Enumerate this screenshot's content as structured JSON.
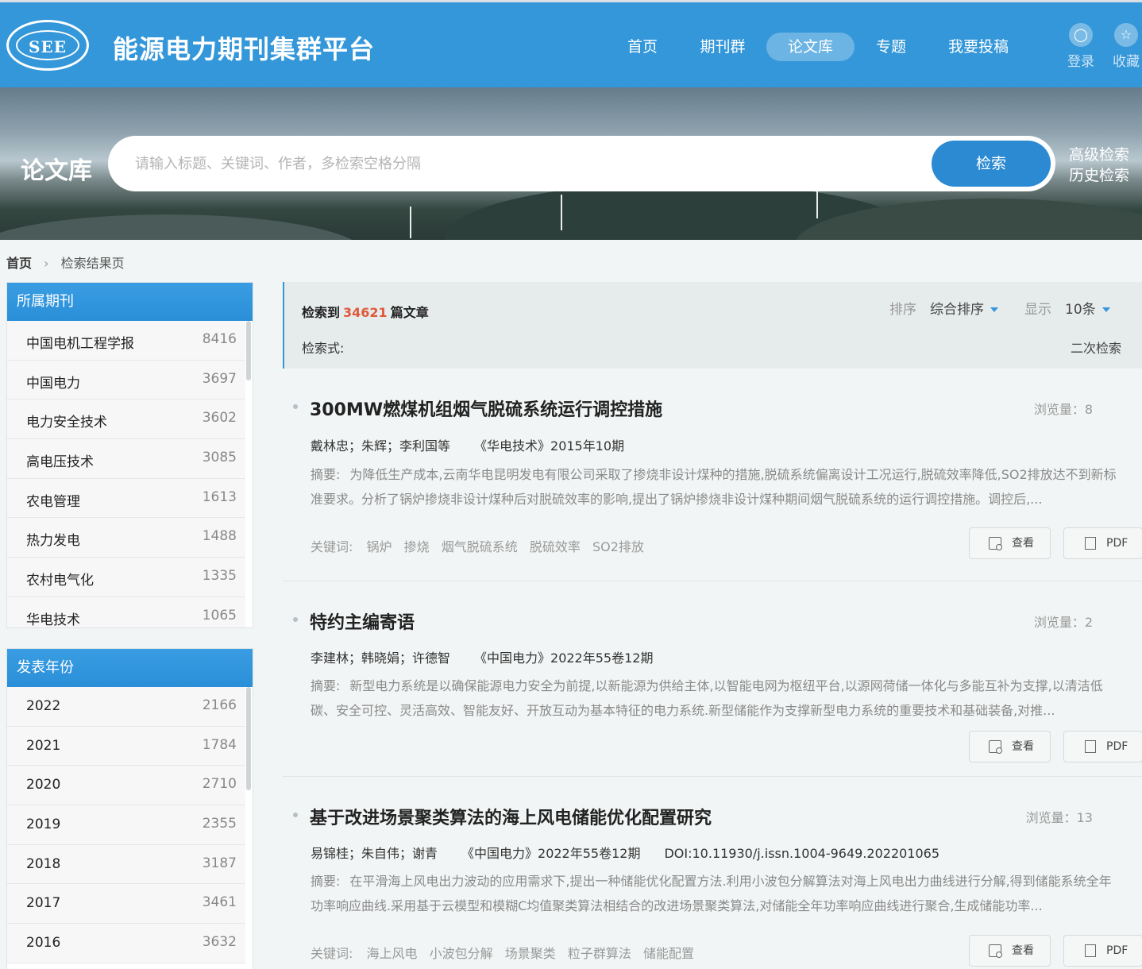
{
  "header": {
    "logo_text": "SEE",
    "logo_ring_text": "中国电机工程学会",
    "site_title": "能源电力期刊集群平台",
    "nav": [
      "首页",
      "期刊群",
      "论文库",
      "专题",
      "我要投稿"
    ],
    "login": "登录",
    "favorite": "收藏"
  },
  "banner": {
    "title": "论文库",
    "search_placeholder": "请输入标题、关键词、作者，多检索空格分隔",
    "search_button": "检索",
    "advanced": "高级检索",
    "history": "历史检索"
  },
  "breadcrumb": {
    "home": "首页",
    "current": "检索结果页"
  },
  "journals": {
    "title": "所属期刊",
    "items": [
      {
        "name": "中国电机工程学报",
        "count": "8416"
      },
      {
        "name": "中国电力",
        "count": "3697"
      },
      {
        "name": "电力安全技术",
        "count": "3602"
      },
      {
        "name": "高电压技术",
        "count": "3085"
      },
      {
        "name": "农电管理",
        "count": "1613"
      },
      {
        "name": "热力发电",
        "count": "1488"
      },
      {
        "name": "农村电气化",
        "count": "1335"
      },
      {
        "name": "华电技术",
        "count": "1065"
      }
    ]
  },
  "years": {
    "title": "发表年份",
    "items": [
      {
        "name": "2022",
        "count": "2166"
      },
      {
        "name": "2021",
        "count": "1784"
      },
      {
        "name": "2020",
        "count": "2710"
      },
      {
        "name": "2019",
        "count": "2355"
      },
      {
        "name": "2018",
        "count": "3187"
      },
      {
        "name": "2017",
        "count": "3461"
      },
      {
        "name": "2016",
        "count": "3632"
      }
    ]
  },
  "results": {
    "count_prefix": "检索到",
    "count": "34621",
    "count_suffix": "篇文章",
    "query_label": "检索式:",
    "sort_label": "排序",
    "sort_value": "综合排序",
    "display_label": "显示",
    "display_value": "10条",
    "secondary": "二次检索"
  },
  "articles": [
    {
      "title": "300MW燃煤机组烟气脱硫系统运行调控措施",
      "views": "浏览量：8",
      "authors": "戴林忠；朱辉；李利国等",
      "source": "《华电技术》2015年10期",
      "doi": "",
      "abstract_label": "摘要:",
      "abstract": "为降低生产成本,云南华电昆明发电有限公司采取了掺烧非设计煤种的措施,脱硫系统偏离设计工况运行,脱硫效率降低,SO2排放达不到新标准要求。分析了锅炉掺烧非设计煤种后对脱硫效率的影响,提出了锅炉掺烧非设计煤种期间烟气脱硫系统的运行调控措施。调控后,...",
      "keywords_label": "关键词:",
      "keywords": [
        "锅炉",
        "掺烧",
        "烟气脱硫系统",
        "脱硫效率",
        "SO2排放"
      ],
      "view_btn": "查看",
      "pdf_btn": "PDF"
    },
    {
      "title": "特约主编寄语",
      "views": "浏览量：2",
      "authors": "李建林；韩晓娟；许德智",
      "source": "《中国电力》2022年55卷12期",
      "doi": "",
      "abstract_label": "摘要:",
      "abstract": "新型电力系统是以确保能源电力安全为前提,以新能源为供给主体,以智能电网为枢纽平台,以源网荷储一体化与多能互补为支撑,以清洁低碳、安全可控、灵活高效、智能友好、开放互动为基本特征的电力系统.新型储能作为支撑新型电力系统的重要技术和基础装备,对推...",
      "keywords_label": "",
      "keywords": [],
      "view_btn": "查看",
      "pdf_btn": "PDF"
    },
    {
      "title": "基于改进场景聚类算法的海上风电储能优化配置研究",
      "views": "浏览量：13",
      "authors": "易锦桂；朱自伟；谢青",
      "source": "《中国电力》2022年55卷12期",
      "doi": "DOI:10.11930/j.issn.1004-9649.202201065",
      "abstract_label": "摘要:",
      "abstract": "在平滑海上风电出力波动的应用需求下,提出一种储能优化配置方法.利用小波包分解算法对海上风电出力曲线进行分解,得到储能系统全年功率响应曲线.采用基于云模型和模糊C均值聚类算法相结合的改进场景聚类算法,对储能全年功率响应曲线进行聚合,生成储能功率...",
      "keywords_label": "关键词:",
      "keywords": [
        "海上风电",
        "小波包分解",
        "场景聚类",
        "粒子群算法",
        "储能配置"
      ],
      "view_btn": "查看",
      "pdf_btn": "PDF"
    }
  ],
  "colors": {
    "primary": "#3497d9",
    "button": "#2b8ad2",
    "count_highlight": "#e05a3a"
  }
}
